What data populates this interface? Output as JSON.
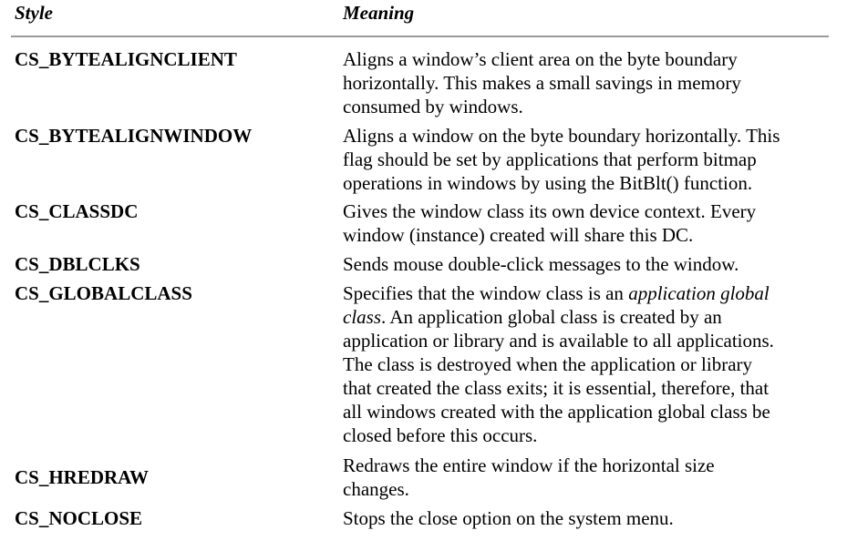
{
  "header": {
    "style_label": "Style",
    "meaning_label": "Meaning"
  },
  "rows": [
    {
      "style": "CS_BYTEALIGNCLIENT",
      "lines": [
        "Aligns a window’s client area on the byte boundary",
        "horizontally. This makes a small savings in memory",
        "consumed by windows."
      ]
    },
    {
      "style": "CS_BYTEALIGNWINDOW",
      "lines": [
        "Aligns a window on the byte boundary horizontally. This",
        "flag should be set by applications that perform bitmap",
        "operations in windows by using the BitBlt() function."
      ]
    },
    {
      "style": "CS_CLASSDC",
      "lines": [
        "Gives the window class its own device context. Every",
        "window (instance) created will share this DC."
      ]
    },
    {
      "style": "CS_DBLCLKS",
      "lines": [
        "Sends mouse double-click messages to the window."
      ]
    },
    {
      "style": "CS_GLOBALCLASS",
      "lines_pre": "Specifies that the window class is an ",
      "lines_italic_1": "application global",
      "lines_italic_2": "class",
      "lines": [
        ". An application global class is created by an",
        "application or library and is available to all applications.",
        "The class is destroyed when the application or library",
        "that created the class exits; it is essential, therefore, that",
        "all windows created with the application global class be",
        "closed before this occurs."
      ]
    },
    {
      "style": "CS_HREDRAW",
      "lines": [
        "Redraws the entire window if the horizontal size",
        "changes."
      ]
    },
    {
      "style": "CS_NOCLOSE",
      "lines": [
        "Stops the close option on the system menu."
      ]
    }
  ]
}
